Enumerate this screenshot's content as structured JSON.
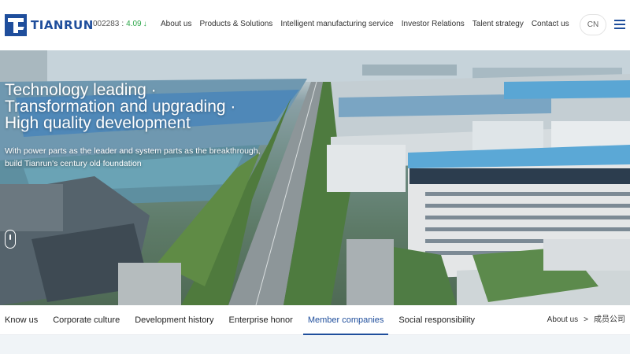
{
  "brand": {
    "name": "TIANRUN",
    "logo_color": "#1f4e9c"
  },
  "stock": {
    "code": "002283",
    "separator": ":",
    "price": "4.09",
    "trend_icon": "arrow-down-icon",
    "trend_symbol": "↓",
    "trend_color": "#2ea84b"
  },
  "nav": {
    "items": [
      "About us",
      "Products & Solutions",
      "Intelligent manufacturing service",
      "Investor Relations",
      "Talent strategy",
      "Contact us"
    ]
  },
  "lang": {
    "label": "CN"
  },
  "hero": {
    "title_lines": [
      "Technology leading ·",
      "Transformation and upgrading ·",
      "High quality development"
    ],
    "subtitle_lines": [
      "With power parts as the leader and system parts as the breakthrough,",
      "build Tianrun's century old foundation"
    ]
  },
  "subnav": {
    "items": [
      "Know us",
      "Corporate culture",
      "Development history",
      "Enterprise honor",
      "Member companies",
      "Social responsibility"
    ],
    "active": "Member companies",
    "accent": "#1f4e9c"
  },
  "breadcrumb": {
    "parent": "About us",
    "separator": ">",
    "current": "成员公司"
  }
}
